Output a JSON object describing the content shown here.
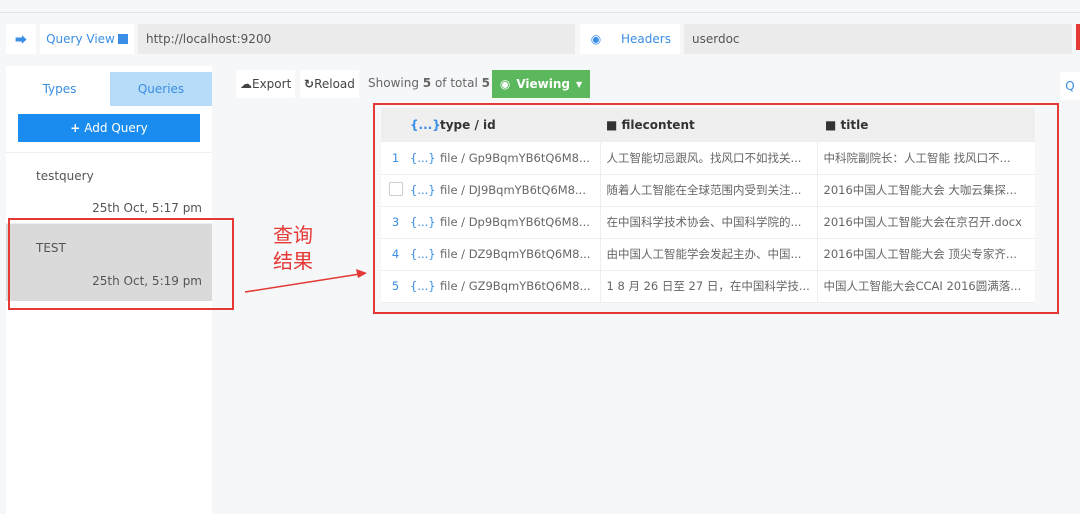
{
  "topbar": {
    "query_view": "Query View",
    "url": "http://localhost:9200",
    "headers": "Headers",
    "types_input": "userdoc"
  },
  "sidebar": {
    "tabs": [
      "Types",
      "Queries"
    ],
    "add_query": "Add Query",
    "queries": [
      {
        "name": "testquery",
        "time": "25th Oct, 5:17 pm"
      },
      {
        "name": "TEST",
        "time": "25th Oct, 5:19 pm",
        "selected": true
      }
    ]
  },
  "toolbar": {
    "export": "Export",
    "reload": "Reload",
    "showing_prefix": "Showing",
    "shown": "5",
    "of_total": "of total",
    "total": "5",
    "viewing": "Viewing",
    "right_button": "Q"
  },
  "table": {
    "columns": [
      "type / id",
      "filecontent",
      "title"
    ],
    "brace": "{...}",
    "rows": [
      {
        "num": "1",
        "id": "file / Gp9BqmYB6tQ6M8...",
        "filecontent": "人工智能切忌跟风。找风口不如找关...",
        "title": "中科院副院长：人工智能 找风口不..."
      },
      {
        "num": "",
        "id": "file / DJ9BqmYB6tQ6M8...",
        "filecontent": "随着人工智能在全球范围内受到关注...",
        "title": "2016中国人工智能大会 大咖云集探..."
      },
      {
        "num": "3",
        "id": "file / Dp9BqmYB6tQ6M8...",
        "filecontent": "在中国科学技术协会、中国科学院的...",
        "title": "2016中国人工智能大会在京召开.docx"
      },
      {
        "num": "4",
        "id": "file / DZ9BqmYB6tQ6M8...",
        "filecontent": "由中国人工智能学会发起主办、中国...",
        "title": "2016中国人工智能大会 顶尖专家齐..."
      },
      {
        "num": "5",
        "id": "file / GZ9BqmYB6tQ6M8...",
        "filecontent": "1 8 月 26 日至 27 日，在中国科学技...",
        "title": "中国人工智能大会CCAI 2016圆满落..."
      }
    ]
  },
  "annotation": {
    "line1": "查询",
    "line2": "结果",
    "color": "#e53935"
  }
}
